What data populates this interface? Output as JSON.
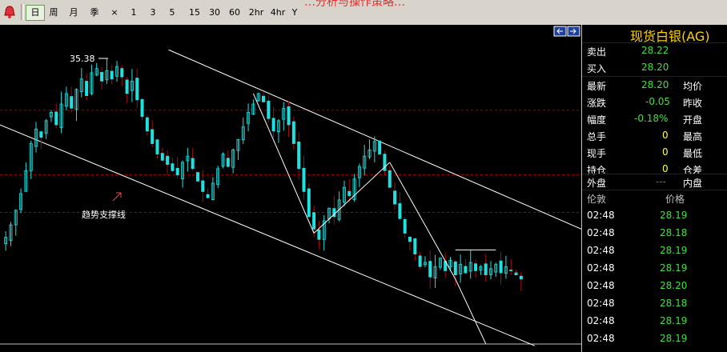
{
  "toolbar": {
    "headline": "…分析与操作策略…",
    "periods": [
      "日",
      "周",
      "月",
      "季",
      "×",
      "1",
      "3",
      "5",
      "15",
      "30",
      "60",
      "2hr",
      "4hr",
      "Y"
    ],
    "active_period": "日"
  },
  "chart_data": {
    "type": "candlestick",
    "title": "",
    "annotations": {
      "high_label": "35.38",
      "trend_support_label": "趋势支撑线"
    },
    "price_range": [
      21.5,
      37.2
    ],
    "reference_lines": [
      33.1,
      30.0,
      28.2
    ],
    "candles_count": 190,
    "trend_channel": {
      "upper": {
        "from": [
          0.29,
          36.0
        ],
        "to": [
          1.0,
          27.4
        ]
      },
      "lower": {
        "from": [
          0.0,
          32.4
        ],
        "to": [
          0.92,
          21.8
        ]
      }
    },
    "approx_closes": [
      27.0,
      27.6,
      28.3,
      29.1,
      30.2,
      31.5,
      32.2,
      31.8,
      32.6,
      33.0,
      32.4,
      33.4,
      33.9,
      33.2,
      34.1,
      34.6,
      33.8,
      34.9,
      35.1,
      34.5,
      35.0,
      34.6,
      35.2,
      34.7,
      33.9,
      34.5,
      33.6,
      32.8,
      32.1,
      31.5,
      31.0,
      30.7,
      30.5,
      30.2,
      30.0,
      30.6,
      30.9,
      30.3,
      29.7,
      29.2,
      28.9,
      29.6,
      30.3,
      31.0,
      30.4,
      31.2,
      31.7,
      32.3,
      33.0,
      33.4,
      33.9,
      33.5,
      32.7,
      32.1,
      32.6,
      33.2,
      32.4,
      31.5,
      30.3,
      29.2,
      28.0,
      27.4,
      26.9,
      27.8,
      28.4,
      28.0,
      28.8,
      29.4,
      29.0,
      29.8,
      30.4,
      30.9,
      31.2,
      31.6,
      31.0,
      30.2,
      29.4,
      28.6,
      27.9,
      27.2,
      26.8,
      26.2,
      25.6,
      25.8,
      25.1,
      25.6,
      26.0,
      25.4,
      25.9,
      25.2,
      25.7,
      25.3,
      25.8,
      25.4,
      25.6,
      25.2,
      25.5,
      25.7,
      25.3,
      25.6,
      25.4,
      25.2,
      25.0
    ]
  },
  "panel": {
    "title": "现货白银(AG)",
    "sell_label": "卖出",
    "sell_value": "28.22",
    "buy_label": "买入",
    "buy_value": "28.20",
    "latest_label": "最新",
    "latest_value": "28.20",
    "avg_label": "均价",
    "change_label": "涨跌",
    "change_value": "-0.05",
    "prevclose_label": "昨收",
    "pct_label": "幅度",
    "pct_value": "-0.18%",
    "open_label": "开盘",
    "total_label": "总手",
    "total_value": "0",
    "high_label": "最高",
    "current_label": "现手",
    "current_value": "0",
    "low_label": "最低",
    "hold_label": "持仓",
    "hold_value": "0",
    "diff_label": "仓差",
    "outer_label": "外盘",
    "outer_value": "---",
    "inner_label": "内盘",
    "col_time": "伦敦",
    "col_price": "价格",
    "ticks": [
      {
        "time": "02:48",
        "price": "28.19"
      },
      {
        "time": "02:48",
        "price": "28.18"
      },
      {
        "time": "02:48",
        "price": "28.19"
      },
      {
        "time": "02:48",
        "price": "28.19"
      },
      {
        "time": "02:48",
        "price": "28.20"
      },
      {
        "time": "02:48",
        "price": "28.18"
      },
      {
        "time": "02:48",
        "price": "28.19"
      },
      {
        "time": "02:48",
        "price": "28.19"
      }
    ]
  },
  "colors": {
    "candle": "#20e0e0",
    "candle_down": "#a01010",
    "ref_line": "#a00000",
    "channel": "#ffffff",
    "price_green": "#40e040"
  }
}
